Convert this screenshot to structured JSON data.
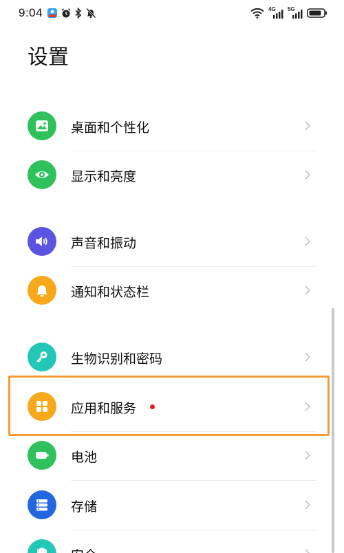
{
  "status_bar": {
    "time": "9:04",
    "left_icons": [
      "app-notification-icon",
      "alarm-icon",
      "bluetooth-icon",
      "mute-icon"
    ],
    "right_icons": [
      "wifi-icon",
      "signal-4g-icon",
      "signal-5g-icon",
      "battery-icon"
    ],
    "signal_4g_label": "4G",
    "signal_5g_label": "5G"
  },
  "page": {
    "title": "设置"
  },
  "settings": {
    "items": [
      {
        "label": "桌面和个性化",
        "icon": "image-icon",
        "color": "#2fc15b"
      },
      {
        "label": "显示和亮度",
        "icon": "eye-icon",
        "color": "#2fc15b"
      },
      {
        "label": "声音和振动",
        "icon": "speaker-icon",
        "color": "#5b54e0"
      },
      {
        "label": "通知和状态栏",
        "icon": "bell-icon",
        "color": "#f7a81b"
      },
      {
        "label": "生物识别和密码",
        "icon": "key-icon",
        "color": "#23c7b5"
      },
      {
        "label": "应用和服务",
        "icon": "apps-grid-icon",
        "color": "#f7a81b",
        "badge": "red-dot"
      },
      {
        "label": "电池",
        "icon": "battery-icon",
        "color": "#2fc15b"
      },
      {
        "label": "存储",
        "icon": "storage-icon",
        "color": "#2266e0"
      },
      {
        "label": "安全",
        "icon": "shield-icon",
        "color": "#23c7b5"
      }
    ]
  },
  "colors": {
    "highlight_border": "#f29c38",
    "badge_red": "#e0201c",
    "divider": "#ececec",
    "chevron": "#c6c6c6"
  }
}
